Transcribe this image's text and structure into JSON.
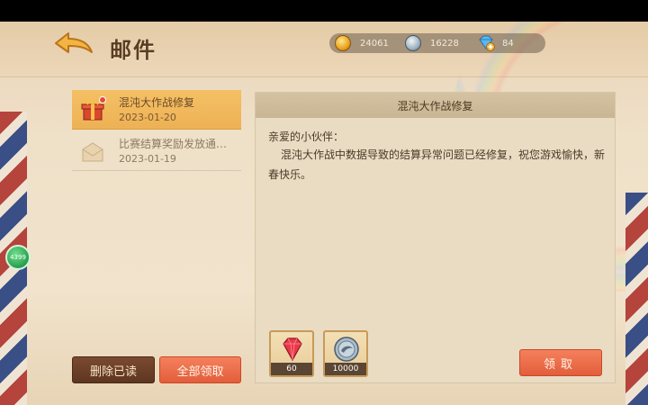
{
  "header": {
    "title": "邮件"
  },
  "currency": {
    "gold": "24061",
    "silver": "16228",
    "gems": "84"
  },
  "mail_list": [
    {
      "title": "混沌大作战修复",
      "date": "2023-01-20",
      "selected": true,
      "unread": true,
      "icon": "gift-icon"
    },
    {
      "title": "比赛结算奖励发放通…",
      "date": "2023-01-19",
      "selected": false,
      "unread": false,
      "icon": "opened-envelope-icon"
    }
  ],
  "actions": {
    "delete_read": "删除已读",
    "collect_all": "全部领取"
  },
  "detail": {
    "title": "混沌大作战修复",
    "greeting": "亲爱的小伙伴：",
    "body": "混沌大作战中数据导致的结算异常问题已经修复，祝您游戏愉快，新春快乐。",
    "rewards": [
      {
        "icon": "ruby-icon",
        "count": "60"
      },
      {
        "icon": "silver-coin-icon",
        "count": "10000"
      }
    ],
    "collect_label": "领取"
  },
  "badge": {
    "label": "4399"
  },
  "colors": {
    "accent_orange": "#e9663f",
    "selected_item": "#f0b659",
    "dark_button": "#6b3f27"
  }
}
